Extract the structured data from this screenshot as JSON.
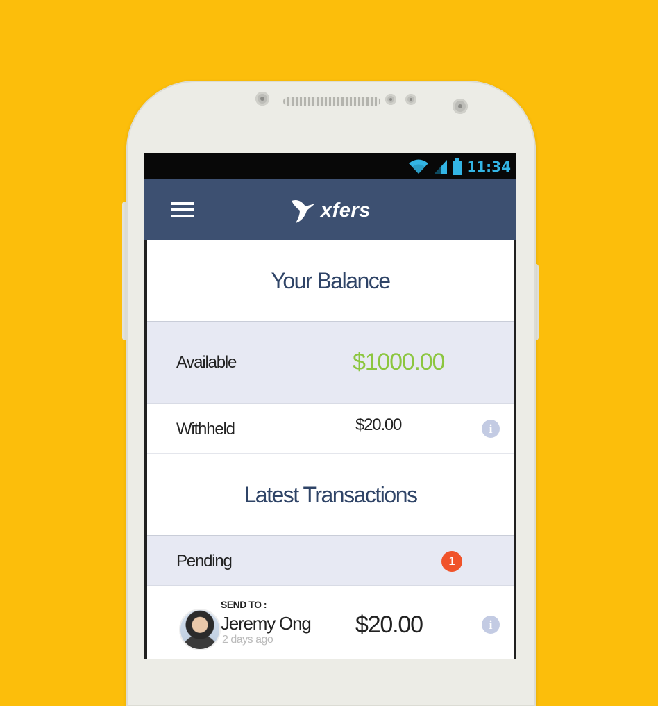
{
  "statusbar": {
    "time": "11:34",
    "icons": [
      "wifi-icon",
      "signal-icon",
      "battery-icon"
    ]
  },
  "header": {
    "logo_text": "xfers",
    "menu_icon": "hamburger-menu-icon"
  },
  "balance": {
    "title": "Your Balance",
    "available_label": "Available",
    "available_value": "$1000.00",
    "withheld_label": "Withheld",
    "withheld_value": "$20.00"
  },
  "transactions": {
    "title": "Latest Transactions",
    "pending_label": "Pending",
    "pending_count": "1",
    "items": [
      {
        "direction": "SEND TO :",
        "name": "Jeremy Ong",
        "time": "2 days ago",
        "amount": "$20.00"
      }
    ]
  },
  "colors": {
    "background": "#FCBE0B",
    "header": "#3D5071",
    "accent_green": "#8CC63F",
    "badge": "#F0532A",
    "row_tint": "#E7E9F3"
  }
}
